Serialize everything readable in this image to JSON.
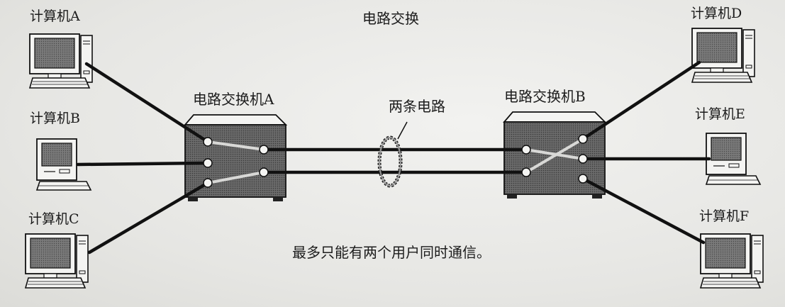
{
  "title": "电路交换",
  "computers": {
    "a": "计算机A",
    "b": "计算机B",
    "c": "计算机C",
    "d": "计算机D",
    "e": "计算机E",
    "f": "计算机F"
  },
  "switches": {
    "a": "电路交换机A",
    "b": "电路交换机B"
  },
  "circuits_label": "两条电路",
  "caption": "最多只能有两个用户同时通信。"
}
